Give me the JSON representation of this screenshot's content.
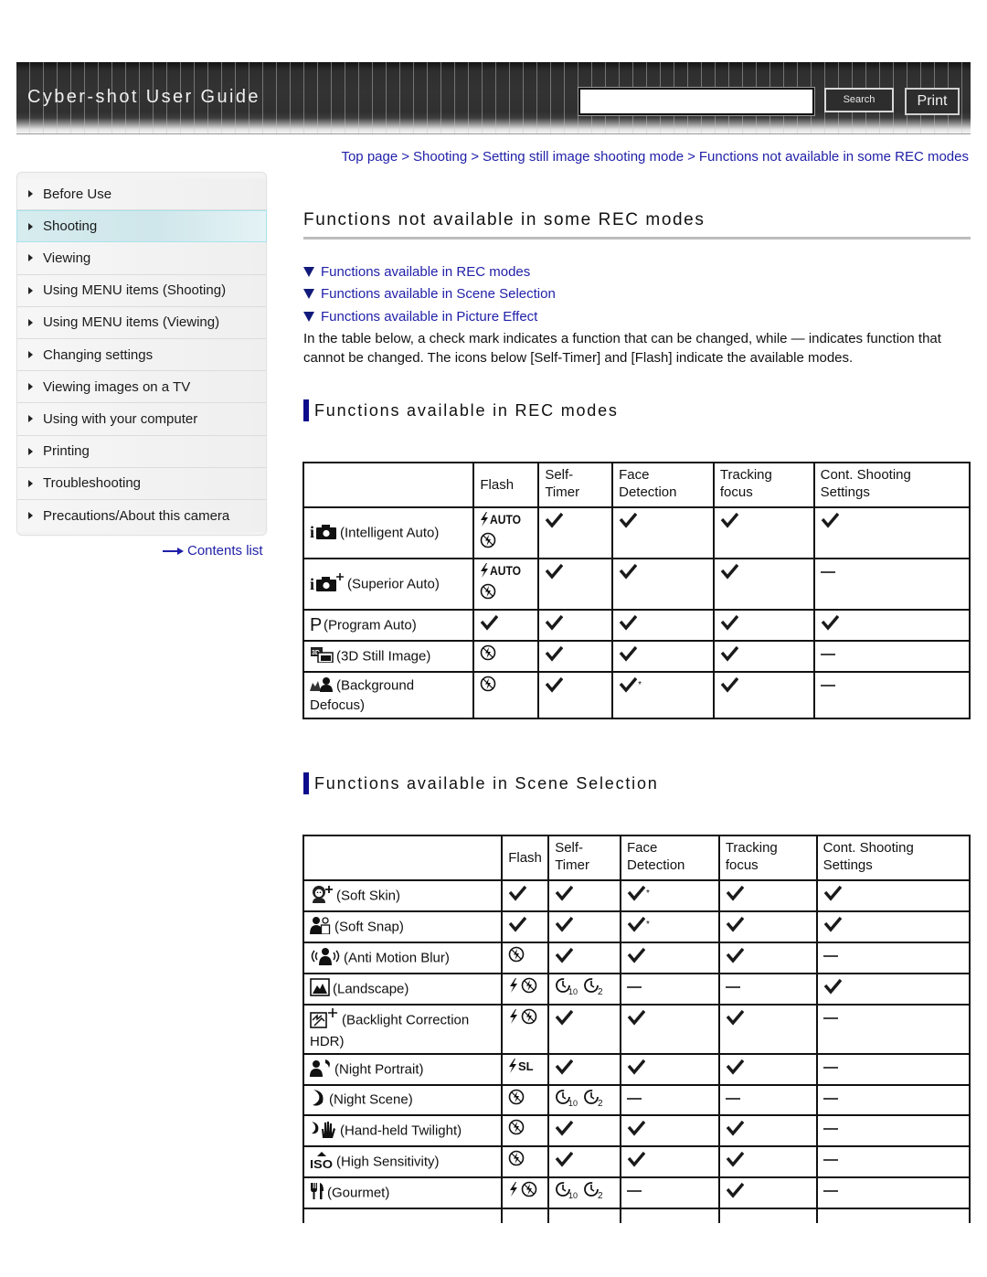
{
  "header": {
    "site_title": "Cyber-shot User Guide",
    "search_placeholder": "",
    "search_value": "",
    "search_button": "Search",
    "print_button": "Print"
  },
  "sidebar": {
    "items": [
      {
        "label": "Before Use",
        "active": false
      },
      {
        "label": "Shooting",
        "active": true
      },
      {
        "label": "Viewing",
        "active": false
      },
      {
        "label": "Using MENU items (Shooting)",
        "active": false
      },
      {
        "label": "Using MENU items (Viewing)",
        "active": false
      },
      {
        "label": "Changing settings",
        "active": false
      },
      {
        "label": "Viewing images on a TV",
        "active": false
      },
      {
        "label": "Using with your computer",
        "active": false
      },
      {
        "label": "Printing",
        "active": false
      },
      {
        "label": "Troubleshooting",
        "active": false
      },
      {
        "label": "Precautions/About this camera",
        "active": false
      }
    ],
    "contents_link": "Contents list"
  },
  "breadcrumb": {
    "items": [
      "Top page",
      "Shooting",
      "Setting still image shooting mode",
      "Functions not available in some REC modes"
    ],
    "separator": ">"
  },
  "page": {
    "title": "Functions not available in some REC modes",
    "anchors": [
      "Functions available in REC modes",
      "Functions available in Scene Selection",
      "Functions available in Picture Effect"
    ],
    "intro": "In the table below, a check mark indicates a function that can be changed, while — indicates function that cannot be changed. The icons below [Self-Timer] and [Flash] indicate the available modes."
  },
  "colors": {
    "link": "#1f1fa8",
    "section_bar": "#0c0c8c",
    "active_nav": "#d6ecef",
    "header_dark": "#333333"
  },
  "rec_modes": {
    "heading": "Functions available in REC modes",
    "columns": [
      "",
      "Flash",
      "Self-\nTimer",
      "Face\nDetection",
      "Tracking\nfocus",
      "Cont. Shooting\nSettings"
    ],
    "rows": [
      {
        "icon": "intelligent-auto-icon",
        "label": "(Intelligent Auto)",
        "flash": [
          "flash-auto",
          "flash-off"
        ],
        "self_timer": "check",
        "face": "check",
        "tracking": "check",
        "cont": "check"
      },
      {
        "icon": "superior-auto-icon",
        "label": "(Superior Auto)",
        "flash": [
          "flash-auto",
          "flash-off"
        ],
        "self_timer": "check",
        "face": "check",
        "tracking": "check",
        "cont": "dash"
      },
      {
        "icon": "program-auto-icon",
        "label": "(Program Auto)",
        "flash": [
          "check"
        ],
        "self_timer": "check",
        "face": "check",
        "tracking": "check",
        "cont": "check"
      },
      {
        "icon": "3d-still-image-icon",
        "label": "(3D Still Image)",
        "flash": [
          "flash-off"
        ],
        "self_timer": "check",
        "face": "check",
        "tracking": "check",
        "cont": "dash"
      },
      {
        "icon": "background-defocus-icon",
        "label": "(Background Defocus)",
        "flash": [
          "flash-off"
        ],
        "self_timer": "check",
        "face": "check*",
        "tracking": "check",
        "cont": "dash"
      }
    ]
  },
  "scene_selection": {
    "heading": "Functions available in Scene Selection",
    "columns": [
      "",
      "Flash",
      "Self-\nTimer",
      "Face\nDetection",
      "Tracking\nfocus",
      "Cont. Shooting\nSettings"
    ],
    "rows": [
      {
        "icon": "soft-skin-icon",
        "label": "(Soft Skin)",
        "flash": [
          "check"
        ],
        "self_timer": [
          "check"
        ],
        "face": "check*",
        "tracking": "check",
        "cont": "check"
      },
      {
        "icon": "soft-snap-icon",
        "label": "(Soft Snap)",
        "flash": [
          "check"
        ],
        "self_timer": [
          "check"
        ],
        "face": "check*",
        "tracking": "check",
        "cont": "check"
      },
      {
        "icon": "anti-motion-blur-icon",
        "label": "(Anti Motion Blur)",
        "flash": [
          "flash-off"
        ],
        "self_timer": [
          "check"
        ],
        "face": "check",
        "tracking": "check",
        "cont": "dash"
      },
      {
        "icon": "landscape-icon",
        "label": "(Landscape)",
        "flash": [
          "flash-on",
          "flash-off"
        ],
        "self_timer": [
          "timer-10",
          "timer-2"
        ],
        "face": "dash",
        "tracking": "dash",
        "cont": "check"
      },
      {
        "icon": "backlight-correction-hdr-icon",
        "label": "(Backlight Correction HDR)",
        "flash": [
          "flash-on",
          "flash-off"
        ],
        "self_timer": [
          "check"
        ],
        "face": "check",
        "tracking": "check",
        "cont": "dash"
      },
      {
        "icon": "night-portrait-icon",
        "label": "(Night Portrait)",
        "flash": [
          "flash-slow-sync"
        ],
        "self_timer": [
          "check"
        ],
        "face": "check",
        "tracking": "check",
        "cont": "dash"
      },
      {
        "icon": "night-scene-icon",
        "label": "(Night Scene)",
        "flash": [
          "flash-off"
        ],
        "self_timer": [
          "timer-10",
          "timer-2"
        ],
        "face": "dash",
        "tracking": "dash",
        "cont": "dash"
      },
      {
        "icon": "hand-held-twilight-icon",
        "label": "(Hand-held Twilight)",
        "flash": [
          "flash-off"
        ],
        "self_timer": [
          "check"
        ],
        "face": "check",
        "tracking": "check",
        "cont": "dash"
      },
      {
        "icon": "high-sensitivity-icon",
        "label": "(High Sensitivity)",
        "flash": [
          "flash-off"
        ],
        "self_timer": [
          "check"
        ],
        "face": "check",
        "tracking": "check",
        "cont": "dash"
      },
      {
        "icon": "gourmet-icon",
        "label": "(Gourmet)",
        "flash": [
          "flash-on",
          "flash-off"
        ],
        "self_timer": [
          "timer-10",
          "timer-2"
        ],
        "face": "dash",
        "tracking": "check",
        "cont": "dash"
      }
    ]
  }
}
